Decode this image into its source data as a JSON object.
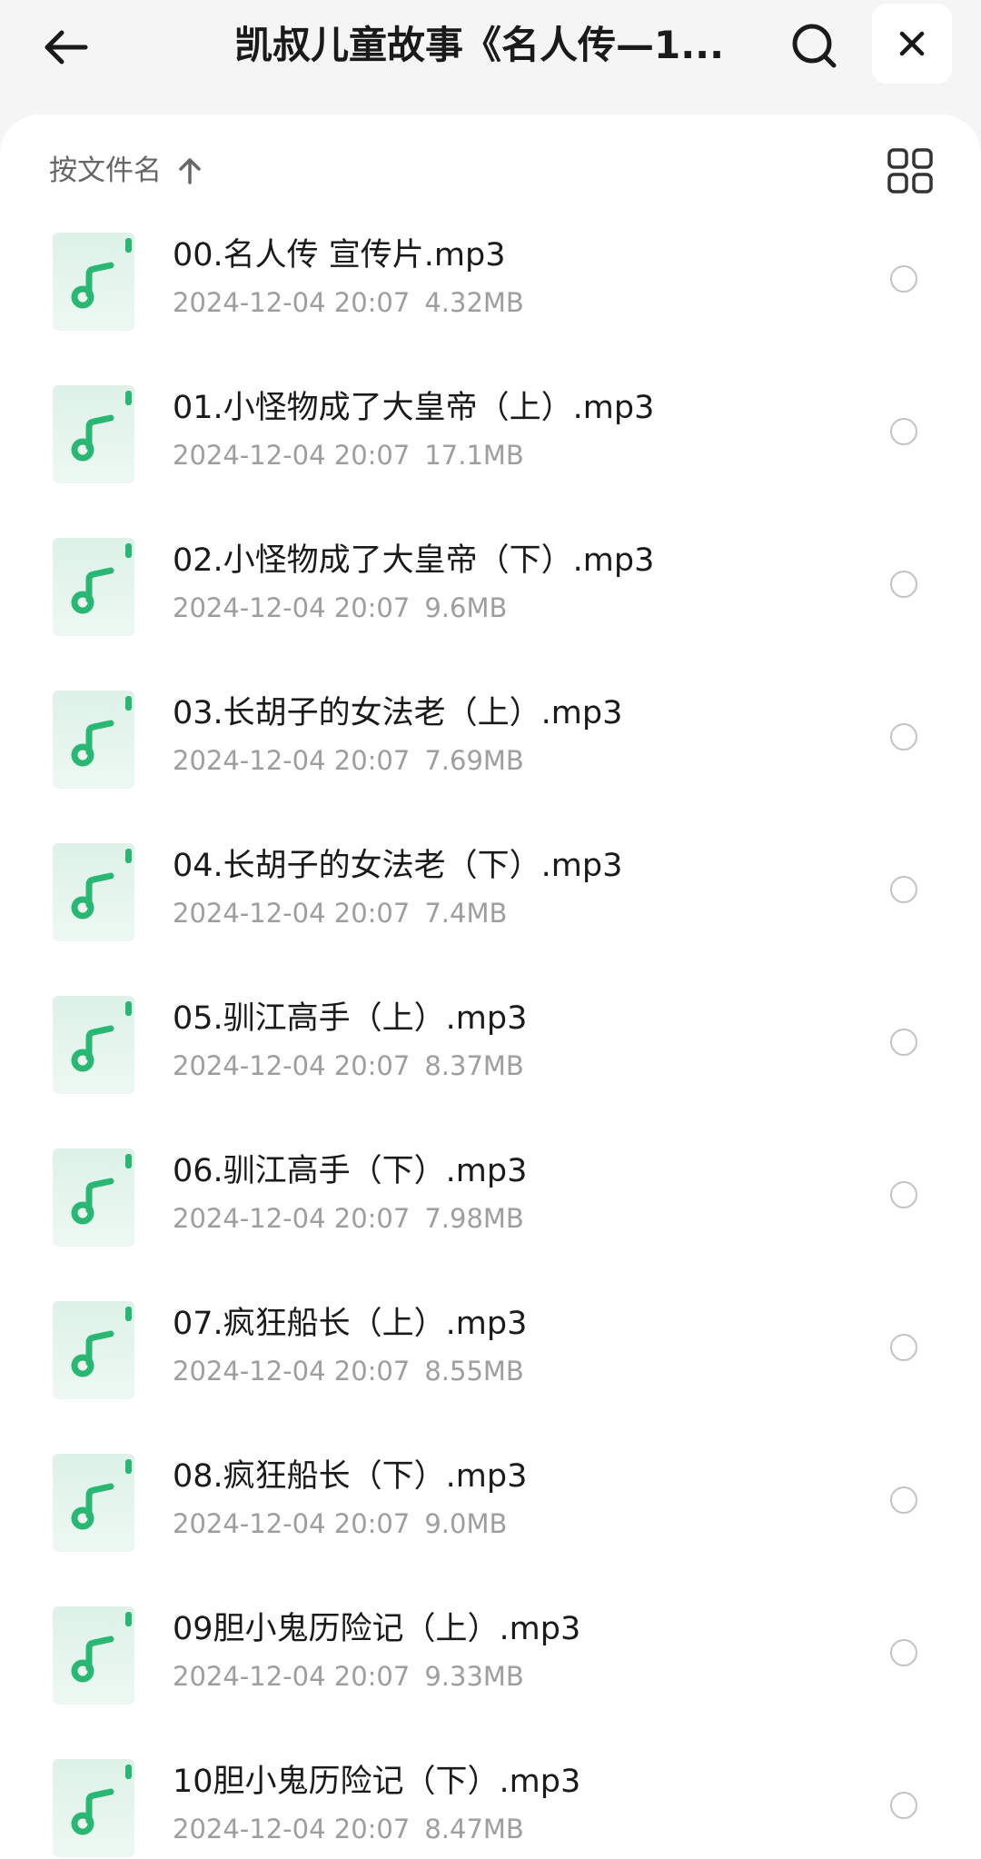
{
  "header": {
    "title": "凯叔儿童故事《名人传—1...",
    "back_icon": "arrow-left-icon",
    "search_icon": "search-icon",
    "close_icon": "close-icon"
  },
  "sort": {
    "label": "按文件名",
    "direction_icon": "arrow-up-icon",
    "view_icon": "grid-view-icon"
  },
  "colors": {
    "accent_green": "#2bb673",
    "icon_bg": "#e8f6ef",
    "meta_gray": "#9e9e9e"
  },
  "files": [
    {
      "name": "00.名人传 宣传片.mp3",
      "date": "2024-12-04 20:07",
      "size": "4.32MB"
    },
    {
      "name": "01.小怪物成了大皇帝（上）.mp3",
      "date": "2024-12-04 20:07",
      "size": "17.1MB"
    },
    {
      "name": "02.小怪物成了大皇帝（下）.mp3",
      "date": "2024-12-04 20:07",
      "size": "9.6MB"
    },
    {
      "name": "03.长胡子的女法老（上）.mp3",
      "date": "2024-12-04 20:07",
      "size": "7.69MB"
    },
    {
      "name": "04.长胡子的女法老（下）.mp3",
      "date": "2024-12-04 20:07",
      "size": "7.4MB"
    },
    {
      "name": "05.驯江高手（上）.mp3",
      "date": "2024-12-04 20:07",
      "size": "8.37MB"
    },
    {
      "name": "06.驯江高手（下）.mp3",
      "date": "2024-12-04 20:07",
      "size": "7.98MB"
    },
    {
      "name": "07.疯狂船长（上）.mp3",
      "date": "2024-12-04 20:07",
      "size": "8.55MB"
    },
    {
      "name": "08.疯狂船长（下）.mp3",
      "date": "2024-12-04 20:07",
      "size": "9.0MB"
    },
    {
      "name": "09胆小鬼历险记（上）.mp3",
      "date": "2024-12-04 20:07",
      "size": "9.33MB"
    },
    {
      "name": "10胆小鬼历险记（下）.mp3",
      "date": "2024-12-04 20:07",
      "size": "8.47MB"
    }
  ]
}
